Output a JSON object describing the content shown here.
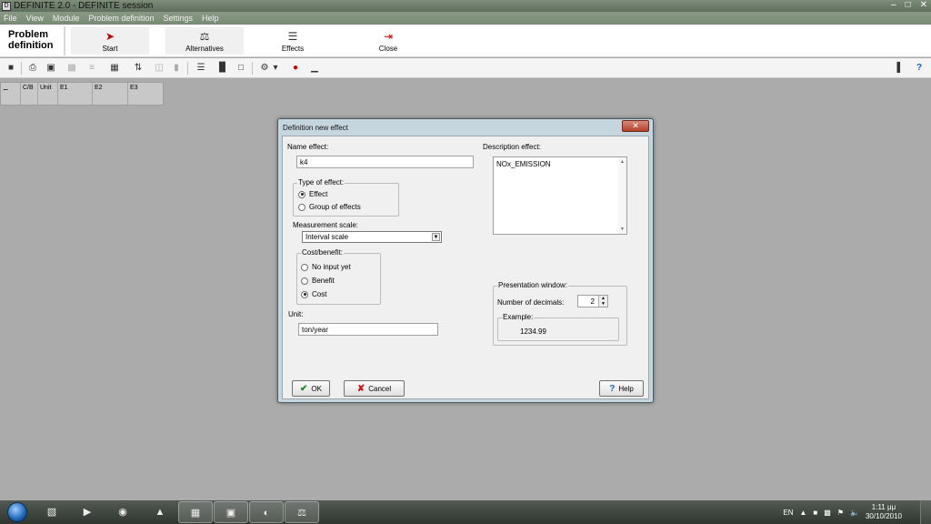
{
  "window": {
    "title": "DEFINITE 2.0 - DEFINITE session",
    "app_icon": "D"
  },
  "menu": [
    "File",
    "View",
    "Module",
    "Problem definition",
    "Settings",
    "Help"
  ],
  "ribbon": {
    "section_title": "Problem definition",
    "buttons": [
      {
        "label": "Start",
        "icon": "flag-icon"
      },
      {
        "label": "Alternatives",
        "icon": "alternatives-icon"
      },
      {
        "label": "Effects",
        "icon": "effects-icon"
      },
      {
        "label": "Close",
        "icon": "close-arrow-icon"
      }
    ]
  },
  "grid": {
    "columns": [
      "",
      "C/B",
      "Unit",
      "E1",
      "E2",
      "E3"
    ]
  },
  "dialog": {
    "title": "Definition new effect",
    "name_label": "Name effect:",
    "name_value": "k4",
    "description_label": "Description effect:",
    "description_value": "NOx_EMISSION",
    "type_group": "Type of  effect:",
    "type_options": [
      "Effect",
      "Group of effects"
    ],
    "type_selected": "Effect",
    "scale_label": "Measurement scale:",
    "scale_value": "Interval scale",
    "cb_group": "Cost/benefit:",
    "cb_options": [
      "No input yet",
      "Benefit",
      "Cost"
    ],
    "cb_selected": "Cost",
    "unit_label": "Unit:",
    "unit_value": "ton/year",
    "presentation_group": "Presentation window:",
    "decimals_label": "Number of decimals:",
    "decimals_value": "2",
    "example_group": "Example:",
    "example_value": "1234.99",
    "ok_label": "OK",
    "cancel_label": "Cancel",
    "help_label": "Help"
  },
  "taskbar": {
    "language": "EN",
    "time": "1:11 μμ",
    "date": "30/10/2010"
  },
  "colors": {
    "dialog_frame": "#c6d6de",
    "close_button": "#b4402a",
    "ok_check": "#1c8a1c",
    "cancel_x": "#c01818"
  }
}
